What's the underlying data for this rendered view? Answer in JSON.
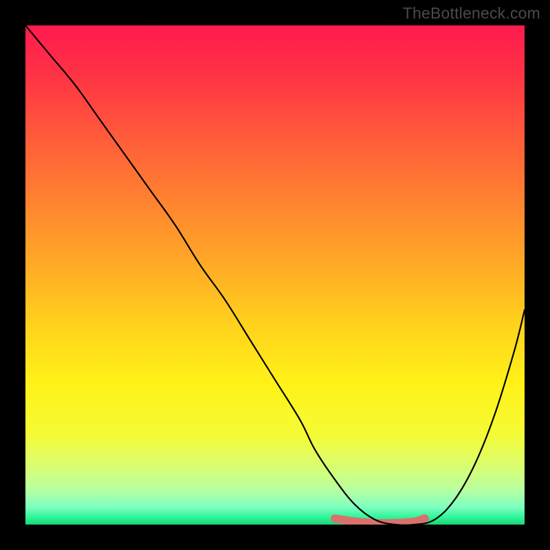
{
  "watermark": "TheBottleneck.com",
  "gradient": {
    "stops": [
      {
        "offset": 0.0,
        "color": "#ff1a4f"
      },
      {
        "offset": 0.1,
        "color": "#ff3345"
      },
      {
        "offset": 0.22,
        "color": "#ff5a3a"
      },
      {
        "offset": 0.35,
        "color": "#ff8230"
      },
      {
        "offset": 0.48,
        "color": "#ffaa26"
      },
      {
        "offset": 0.6,
        "color": "#ffd21c"
      },
      {
        "offset": 0.72,
        "color": "#fff218"
      },
      {
        "offset": 0.82,
        "color": "#f4fb36"
      },
      {
        "offset": 0.88,
        "color": "#dcfd6e"
      },
      {
        "offset": 0.93,
        "color": "#b8ffa0"
      },
      {
        "offset": 0.965,
        "color": "#7effc0"
      },
      {
        "offset": 0.985,
        "color": "#30f59a"
      },
      {
        "offset": 1.0,
        "color": "#18d877"
      }
    ]
  },
  "chart_data": {
    "type": "line",
    "title": "",
    "xlabel": "",
    "ylabel": "",
    "xlim": [
      0,
      100
    ],
    "ylim": [
      0,
      100
    ],
    "series": [
      {
        "name": "bottleneck-curve",
        "x": [
          0,
          5,
          10,
          15,
          20,
          25,
          30,
          35,
          40,
          45,
          50,
          55,
          58,
          62,
          66,
          70,
          74,
          78,
          82,
          86,
          90,
          94,
          98,
          100
        ],
        "y": [
          100,
          94,
          88,
          81,
          74,
          67,
          60,
          52,
          45,
          37,
          29,
          21,
          15,
          9,
          4,
          1,
          0,
          0,
          1,
          5,
          12,
          22,
          35,
          43
        ]
      },
      {
        "name": "flat-zone-highlight",
        "x": [
          62,
          66,
          70,
          74,
          78,
          80
        ],
        "y": [
          1.2,
          0.6,
          0.3,
          0.3,
          0.6,
          1.2
        ]
      }
    ],
    "highlight_color": "#d9716d",
    "curve_color": "#000000"
  }
}
